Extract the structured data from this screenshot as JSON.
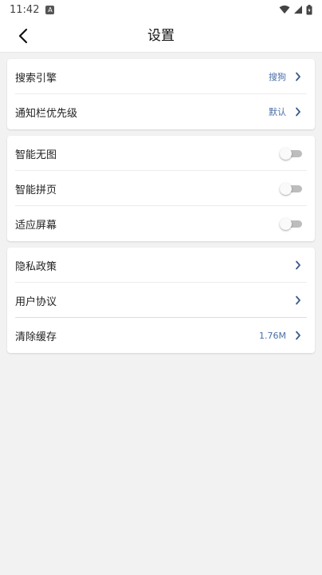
{
  "status_bar": {
    "time": "11:42",
    "notif_glyph": "A"
  },
  "header": {
    "title": "设置"
  },
  "group1": [
    {
      "label": "搜索引擎",
      "value": "搜狗"
    },
    {
      "label": "通知栏优先级",
      "value": "默认"
    }
  ],
  "group2": [
    {
      "label": "智能无图",
      "enabled": false
    },
    {
      "label": "智能拼页",
      "enabled": false
    },
    {
      "label": "适应屏幕",
      "enabled": false
    }
  ],
  "group3": [
    {
      "label": "隐私政策",
      "value": ""
    },
    {
      "label": "用户协议",
      "value": ""
    },
    {
      "label": "清除缓存",
      "value": "1.76M"
    }
  ],
  "colors": {
    "accent_value": "#4a6ea8",
    "chevron": "#3b5a8c",
    "toggle_off": "#bdbdbd"
  },
  "icons": [
    "back-arrow-icon",
    "chevron-right-icon",
    "wifi-icon",
    "signal-icon",
    "battery-icon"
  ]
}
